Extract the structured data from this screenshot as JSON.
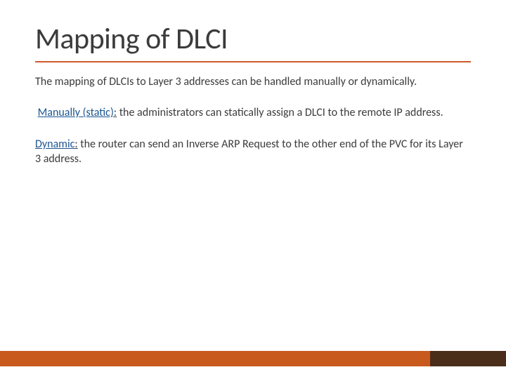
{
  "title": "Mapping of DLCI",
  "intro": "The mapping of DLCIs to Layer 3 addresses can be handled manually or dynamically.",
  "para1": {
    "term": "Manually (static)",
    "suffix": ":",
    "rest": " the administrators can statically assign a DLCI to the remote IP address."
  },
  "para2": {
    "term": "Dynamic",
    "suffix": ":",
    "rest": " the router can send an Inverse ARP Request to the other end of the PVC for its Layer 3 address."
  },
  "colors": {
    "accent_orange": "#c85a1e",
    "accent_brown": "#4a2e1a",
    "term_blue": "#1a5490"
  }
}
